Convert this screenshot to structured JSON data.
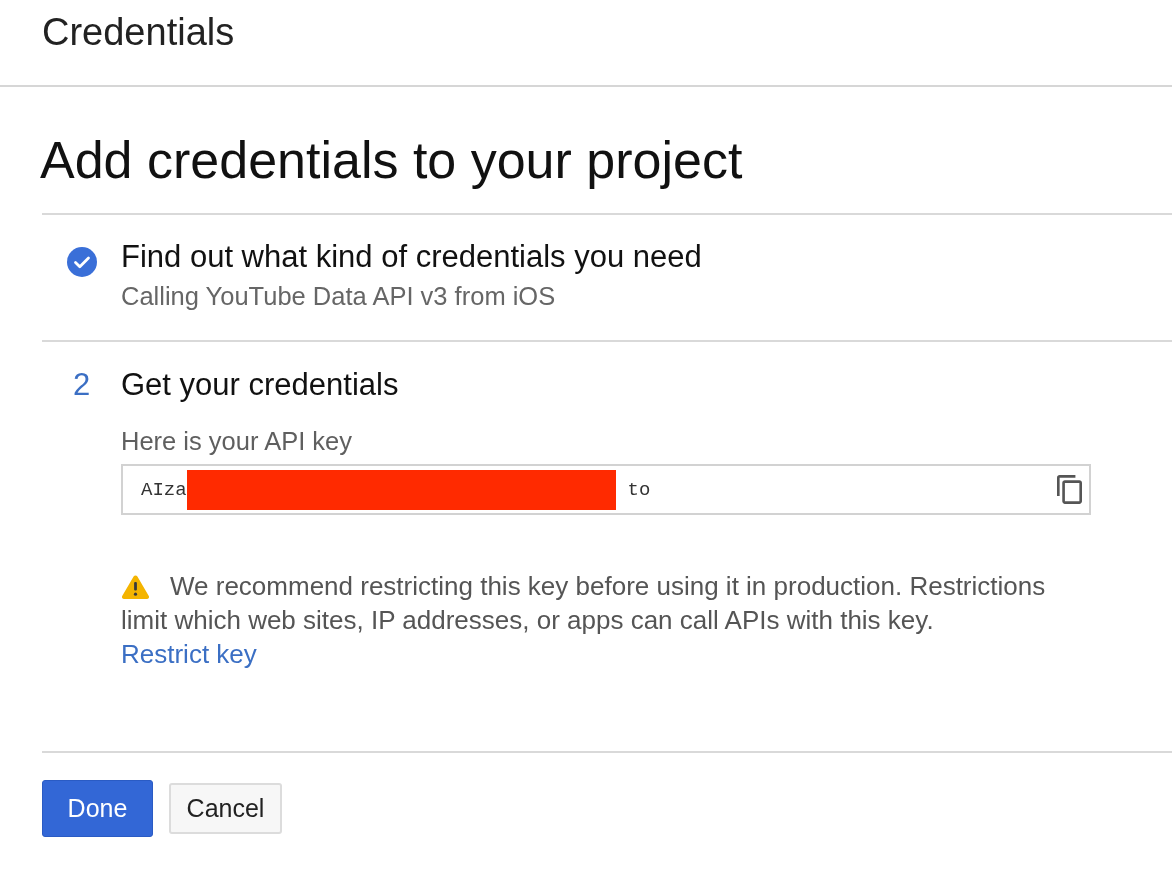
{
  "page_title": "Credentials",
  "heading": "Add credentials to your project",
  "steps": [
    {
      "kind": "done",
      "title": "Find out what kind of credentials you need",
      "subtitle": "Calling YouTube Data API v3 from iOS"
    },
    {
      "kind": "number",
      "number": "2",
      "title": "Get your credentials",
      "api_key": {
        "label": "Here is your API key",
        "value_start": "AIza",
        "value_end": "to"
      },
      "warning": {
        "lines": [
          "We recommend restricting this key before using it in production. Restrictions",
          "limit which web sites, IP addresses, or apps can call APIs with this key."
        ],
        "link": "Restrict key"
      }
    }
  ],
  "buttons": [
    {
      "label": "Done",
      "kind": "primary"
    },
    {
      "label": "Cancel",
      "kind": "secondary"
    }
  ]
}
